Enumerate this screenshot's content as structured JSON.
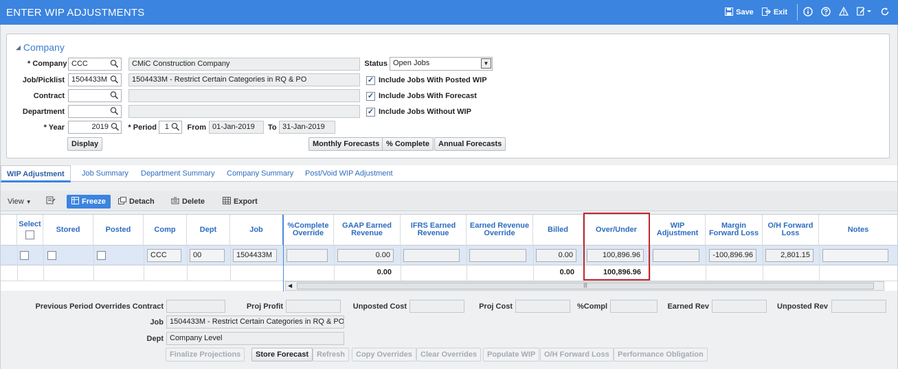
{
  "window": {
    "title": "ENTER WIP ADJUSTMENTS",
    "save_label": "Save",
    "exit_label": "Exit"
  },
  "company_section": {
    "title": "Company",
    "company_label": "Company",
    "company_code": "CCC",
    "company_name": "CMiC Construction Company",
    "job_label": "Job/Picklist",
    "job_code": "1504433M",
    "job_name": "1504433M - Restrict Certain Categories in RQ & PO",
    "contract_label": "Contract",
    "contract_value": "",
    "contract_name": "",
    "department_label": "Department",
    "department_value": "",
    "department_name": "",
    "year_label": "Year",
    "year_value": "2019",
    "period_label": "Period",
    "period_value": "1",
    "from_label": "From",
    "from_value": "01-Jan-2019",
    "to_label": "To",
    "to_value": "31-Jan-2019",
    "status_label": "Status",
    "status_value": "Open Jobs",
    "chk_posted_wip": "Include Jobs With Posted WIP",
    "chk_forecast": "Include Jobs With Forecast",
    "chk_without_wip": "Include Jobs Without WIP",
    "display_btn": "Display",
    "monthly_btn": "Monthly Forecasts",
    "pct_btn": "% Complete",
    "annual_btn": "Annual Forecasts"
  },
  "tabs": [
    "WIP Adjustment",
    "Job Summary",
    "Department Summary",
    "Company Summary",
    "Post/Void WIP Adjustment"
  ],
  "toolbar": {
    "view": "View",
    "freeze": "Freeze",
    "detach": "Detach",
    "delete": "Delete",
    "export": "Export"
  },
  "grid": {
    "headers": {
      "select": "Select",
      "stored": "Stored",
      "posted": "Posted",
      "comp": "Comp",
      "dept": "Dept",
      "job": "Job",
      "pct_line1": "%Complete",
      "pct_line2": "Override",
      "gaap_line1": "GAAP Earned",
      "gaap_line2": "Revenue",
      "ifrs_line1": "IFRS Earned",
      "ifrs_line2": "Revenue",
      "ero_line1": "Earned Revenue",
      "ero_line2": "Override",
      "billed": "Billed",
      "over_under": "Over/Under",
      "wip_line1": "WIP",
      "wip_line2": "Adjustment",
      "mfl_line1": "Margin",
      "mfl_line2": "Forward Loss",
      "ohfl_line1": "O/H Forward",
      "ohfl_line2": "Loss",
      "notes": "Notes"
    },
    "row": {
      "comp": "CCC",
      "dept": "00",
      "job": "1504433M",
      "pct": "",
      "gaap": "0.00",
      "ifrs": "",
      "ero": "",
      "billed": "0.00",
      "over_under": "100,896.96",
      "wip": "",
      "mfl": "-100,896.96",
      "ohfl": "2,801.15",
      "notes": ""
    },
    "totals": {
      "gaap": "0.00",
      "billed": "0.00",
      "over_under": "100,896.96"
    }
  },
  "bottom": {
    "prev_overrides_label": "Previous Period Overrides Contract",
    "proj_profit_label": "Proj Profit",
    "unposted_cost_label": "Unposted Cost",
    "proj_cost_label": "Proj Cost",
    "pct_compl_label": "%Compl",
    "earned_rev_label": "Earned Rev",
    "unposted_rev_label": "Unposted Rev",
    "job_label": "Job",
    "job_value": "1504433M - Restrict Certain Categories in RQ & PO",
    "dept_label": "Dept",
    "dept_value": "Company Level",
    "buttons": {
      "finalize": "Finalize Projections",
      "store": "Store Forecast",
      "refresh": "Refresh",
      "copy": "Copy Overrides",
      "clear": "Clear Overrides",
      "populate": "Populate WIP",
      "ohfl": "O/H Forward Loss",
      "perf": "Performance Obligation"
    }
  },
  "colors": {
    "accent": "#3b84e0",
    "highlight": "#c0282e",
    "selected_row": "#dde7f5"
  }
}
